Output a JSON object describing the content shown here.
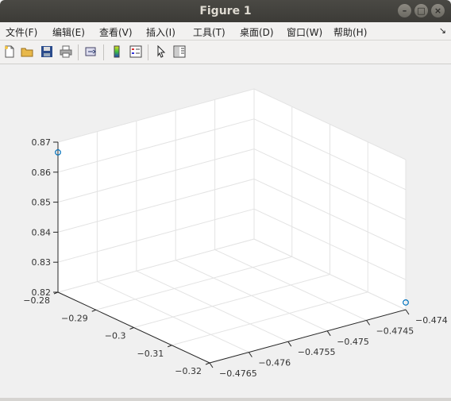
{
  "window": {
    "title": "Figure 1"
  },
  "menu": {
    "items": [
      "文件(F)",
      "编辑(E)",
      "查看(V)",
      "插入(I)",
      "工具(T)",
      "桌面(D)",
      "窗口(W)",
      "帮助(H)"
    ],
    "overflow_icon": "chevron-icon"
  },
  "toolbar": {
    "buttons": [
      "new-figure-icon",
      "open-file-icon",
      "save-icon",
      "print-icon",
      "link-plot-icon",
      "colorbar-icon",
      "legend-icon",
      "pointer-icon",
      "property-editor-icon"
    ]
  },
  "chart_data": {
    "type": "scatter",
    "title": "",
    "xlabel": "",
    "ylabel": "",
    "zlabel": "",
    "xlim": [
      -0.4765,
      -0.474
    ],
    "ylim": [
      -0.32,
      -0.28
    ],
    "zlim": [
      0.82,
      0.87
    ],
    "x_ticks": [
      "-0.4765",
      "-0.476",
      "-0.4755",
      "-0.475",
      "-0.4745",
      "-0.474"
    ],
    "y_ticks": [
      "-0.32",
      "-0.31",
      "-0.3",
      "-0.29",
      "-0.28"
    ],
    "z_ticks": [
      "0.82",
      "0.83",
      "0.84",
      "0.85",
      "0.86",
      "0.87"
    ],
    "marker": "circle",
    "marker_color": "#0072bd",
    "grid": true,
    "points": [
      {
        "x": -0.4765,
        "y": -0.28,
        "z": 0.8666
      },
      {
        "x": -0.474,
        "y": -0.32,
        "z": 0.8224
      }
    ]
  }
}
